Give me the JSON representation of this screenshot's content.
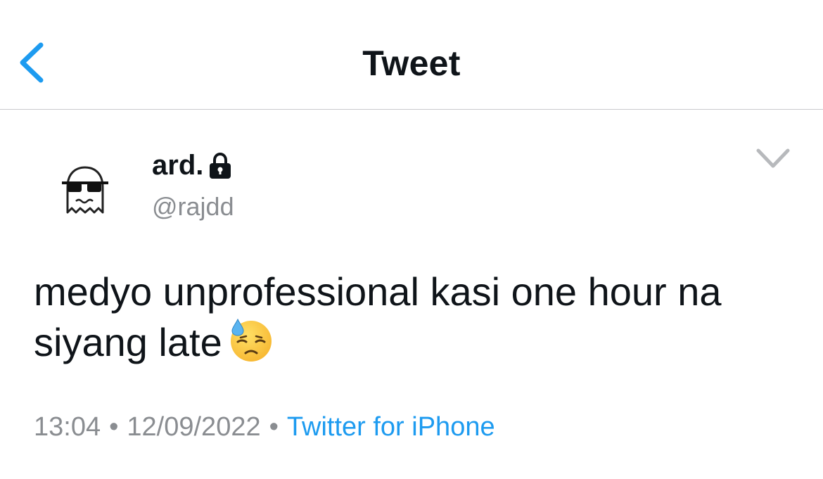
{
  "header": {
    "title": "Tweet",
    "back_icon": "chevron-left-icon",
    "accent_color": "#1d9bf0"
  },
  "tweet": {
    "author": {
      "name": "ard.",
      "handle": "@rajdd",
      "protected_icon": "lock-icon",
      "avatar": "ghost-with-sunglasses-avatar"
    },
    "more_icon": "chevron-down-icon",
    "text": "medyo unprofessional kasi one hour na siyang late",
    "emoji": "downcast-face-with-sweat",
    "time": "13:04",
    "date": "12/09/2022",
    "separator": "•",
    "source": "Twitter for iPhone"
  }
}
